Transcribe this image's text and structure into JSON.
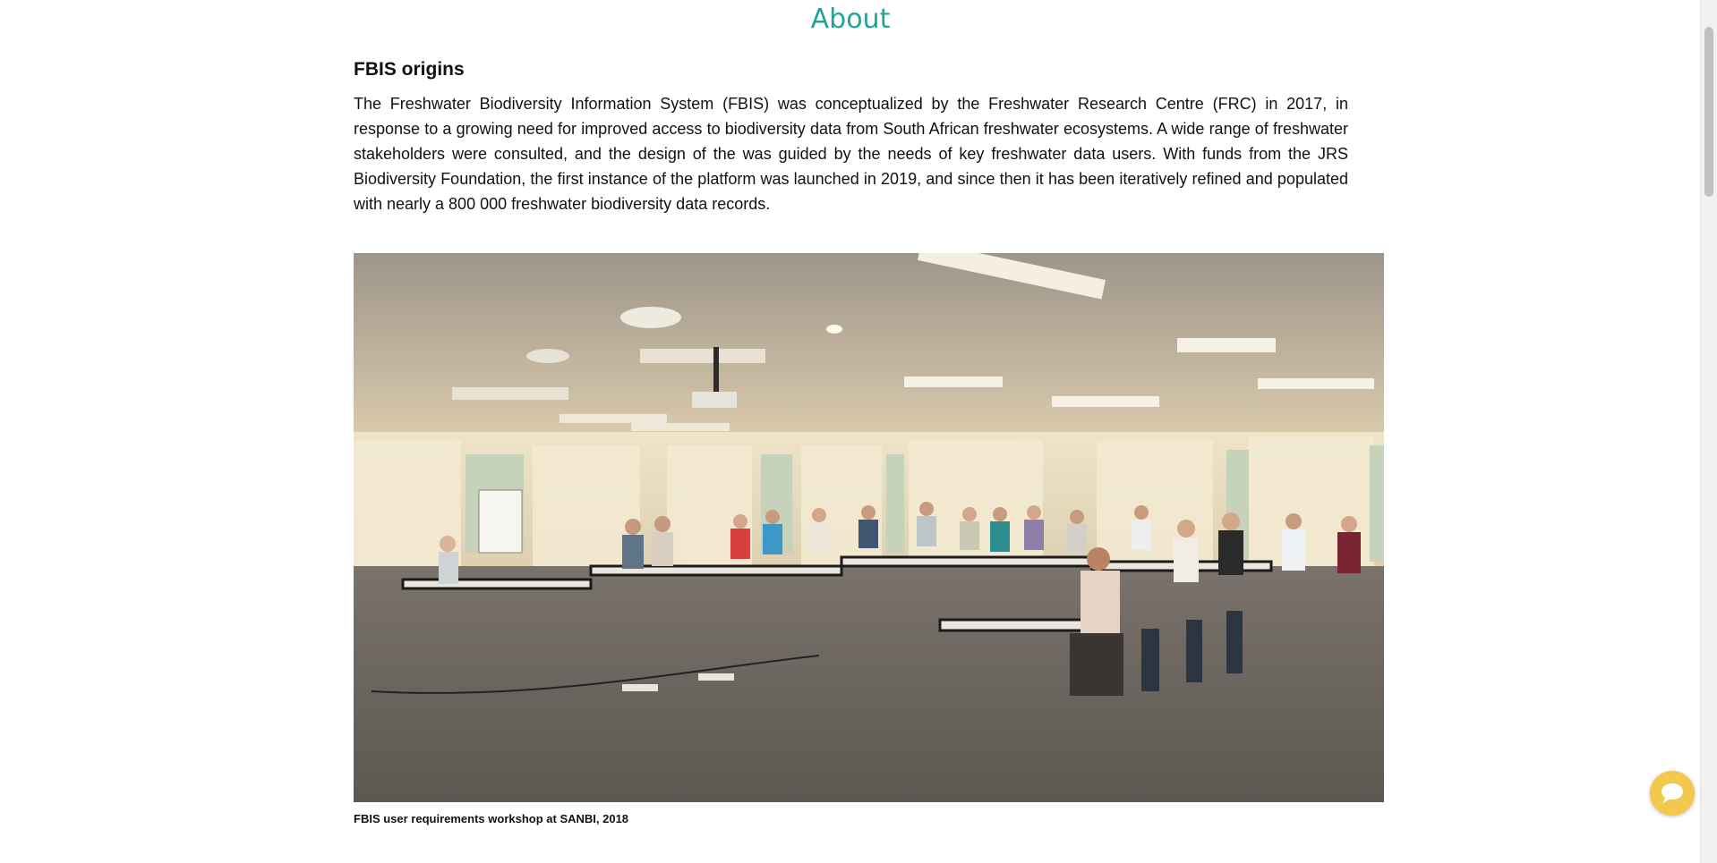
{
  "page": {
    "title": "About"
  },
  "section": {
    "heading": "FBIS origins",
    "paragraph": "The Freshwater Biodiversity Information System (FBIS) was conceptualized by the Freshwater Research Centre (FRC) in 2017, in response to a growing need for improved access to biodiversity data from South African freshwater ecosystems. A wide range of freshwater stakeholders were consulted, and the design of the was guided by the needs of key freshwater data users. With funds from the JRS Biodiversity Foundation, the first instance of the platform was launched in 2019, and since then it has been iteratively refined and populated with nearly a 800 000 freshwater biodiversity data records."
  },
  "figure": {
    "caption": "FBIS user requirements workshop at SANBI, 2018"
  },
  "colors": {
    "title": "#1fa59a",
    "chat_button": "#f2c94c"
  },
  "icons": {
    "chat": "chat-bubble-icon"
  }
}
